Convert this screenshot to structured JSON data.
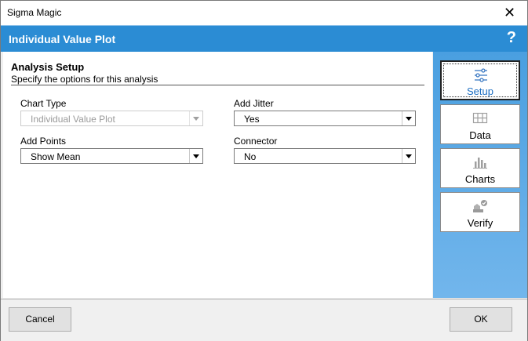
{
  "window": {
    "title": "Sigma Magic",
    "close_glyph": "✕"
  },
  "banner": {
    "title": "Individual Value Plot",
    "help_glyph": "?"
  },
  "section": {
    "title": "Analysis Setup",
    "subtitle": "Specify the options for this analysis"
  },
  "fields": {
    "chart_type": {
      "label": "Chart Type",
      "value": "Individual Value Plot",
      "enabled": false
    },
    "add_jitter": {
      "label": "Add Jitter",
      "value": "Yes"
    },
    "add_points": {
      "label": "Add Points",
      "value": "Show Mean"
    },
    "connector": {
      "label": "Connector",
      "value": "No"
    }
  },
  "nav": {
    "items": [
      {
        "label": "Setup",
        "icon": "sliders-icon",
        "active": true
      },
      {
        "label": "Data",
        "icon": "table-icon",
        "active": false
      },
      {
        "label": "Charts",
        "icon": "bar-chart-icon",
        "active": false
      },
      {
        "label": "Verify",
        "icon": "verify-icon",
        "active": false
      }
    ]
  },
  "buttons": {
    "cancel": "Cancel",
    "ok": "OK"
  },
  "colors": {
    "banner": "#2b8cd4",
    "accent": "#1e6fc2"
  }
}
